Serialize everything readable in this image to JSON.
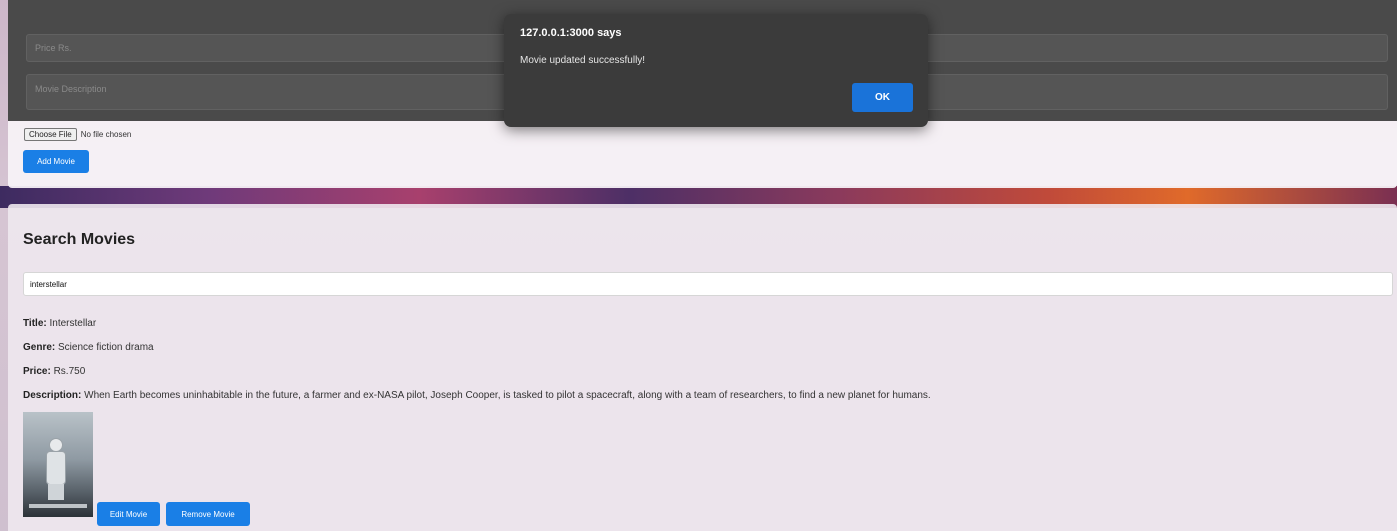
{
  "add_form": {
    "price_placeholder": "Price Rs.",
    "description_placeholder": "Movie Description",
    "file_button": "Choose File",
    "file_status": "No file chosen",
    "add_button": "Add Movie"
  },
  "search": {
    "heading": "Search Movies",
    "query": "interstellar"
  },
  "result": {
    "title_label": "Title:",
    "title_value": "Interstellar",
    "genre_label": "Genre:",
    "genre_value": "Science fiction drama",
    "price_label": "Price:",
    "price_value": "Rs.750",
    "description_label": "Description:",
    "description_value": "When Earth becomes uninhabitable in the future, a farmer and ex-NASA pilot, Joseph Cooper, is tasked to pilot a spacecraft, along with a team of researchers, to find a new planet for humans.",
    "edit_button": "Edit Movie",
    "remove_button": "Remove Movie"
  },
  "dialog": {
    "title": "127.0.0.1:3000 says",
    "message": "Movie updated successfully!",
    "ok_button": "OK"
  },
  "colors": {
    "primary_button": "#1a7fe6",
    "dialog_background": "#3b3b3b",
    "dialog_ok": "#1a73d9"
  }
}
